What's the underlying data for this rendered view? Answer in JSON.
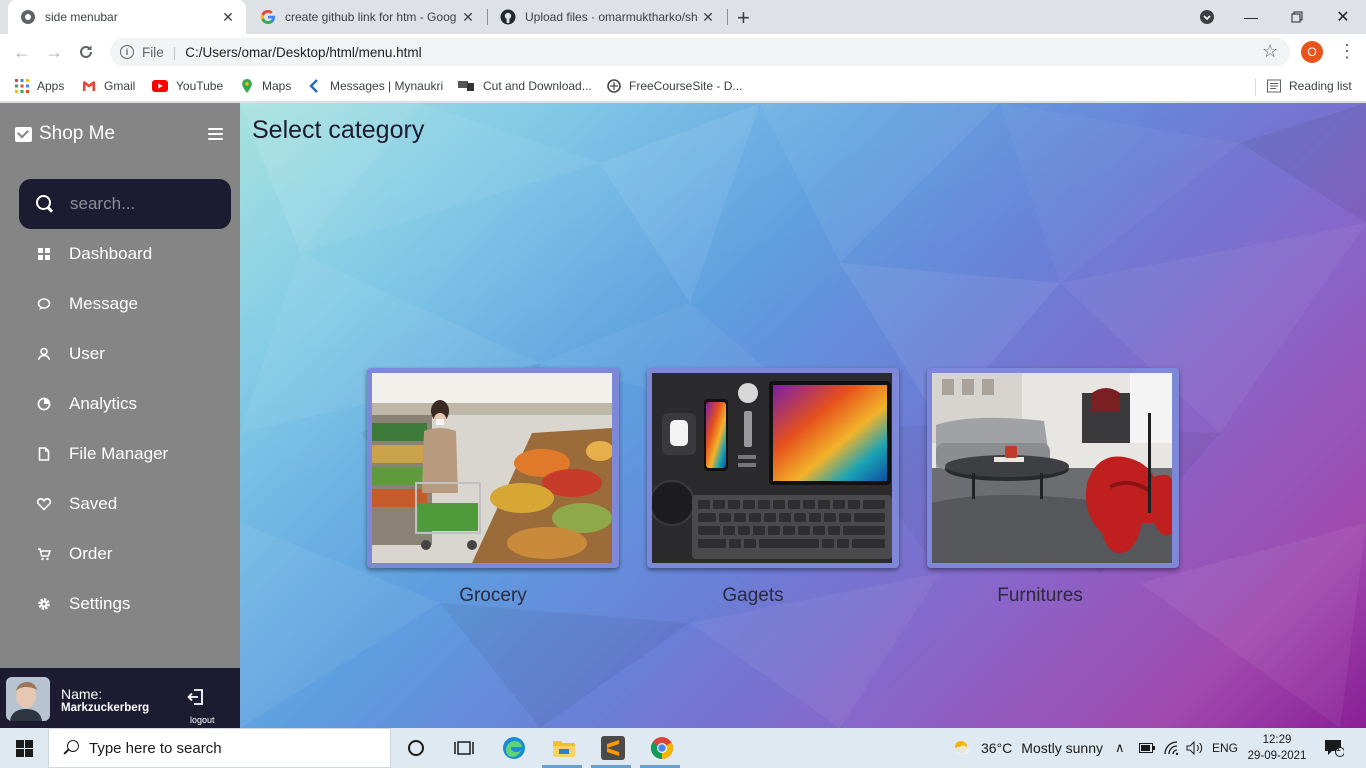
{
  "browser": {
    "tabs": [
      {
        "title": "side menubar",
        "active": true
      },
      {
        "title": "create github link for htm - Goog",
        "active": false
      },
      {
        "title": "Upload files · omarmuktharko/sh",
        "active": false
      }
    ],
    "address": {
      "scheme_label": "File",
      "url": "C:/Users/omar/Desktop/html/menu.html"
    },
    "profile_initial": "O",
    "bookmarks": [
      {
        "label": "Apps",
        "icon": "apps-grid-icon"
      },
      {
        "label": "Gmail",
        "icon": "gmail-icon"
      },
      {
        "label": "YouTube",
        "icon": "youtube-icon"
      },
      {
        "label": "Maps",
        "icon": "maps-icon"
      },
      {
        "label": "Messages | Mynaukri",
        "icon": "naukri-icon"
      },
      {
        "label": "Cut and Download...",
        "icon": "cut-download-icon"
      },
      {
        "label": "FreeCourseSite - D...",
        "icon": "freecoursesite-icon"
      }
    ],
    "reading_list": "Reading list"
  },
  "sidebar": {
    "brand": "Shop Me",
    "search_placeholder": "search...",
    "items": [
      {
        "label": "Dashboard",
        "icon": "dashboard-icon"
      },
      {
        "label": "Message",
        "icon": "message-icon"
      },
      {
        "label": "User",
        "icon": "user-icon"
      },
      {
        "label": "Analytics",
        "icon": "analytics-icon"
      },
      {
        "label": "File Manager",
        "icon": "file-icon"
      },
      {
        "label": "Saved",
        "icon": "heart-icon"
      },
      {
        "label": "Order",
        "icon": "cart-icon"
      },
      {
        "label": "Settings",
        "icon": "gear-icon"
      }
    ],
    "profile": {
      "name_label": "Name:",
      "username": "Markzuckerberg",
      "logout_label": "logout"
    }
  },
  "main": {
    "title": "Select category",
    "categories": [
      {
        "label": "Grocery"
      },
      {
        "label": "Gagets"
      },
      {
        "label": "Furnitures"
      }
    ]
  },
  "taskbar": {
    "search_placeholder": "Type here to search",
    "weather": {
      "temp": "36°C",
      "condition": "Mostly sunny"
    },
    "language": "ENG",
    "time": "12:29",
    "date": "29-09-2021",
    "notification_count": "1"
  },
  "colors": {
    "sidebar_bg": "#858585",
    "sidebar_dark": "#1d1b31",
    "card_border": "#7e88d9"
  }
}
